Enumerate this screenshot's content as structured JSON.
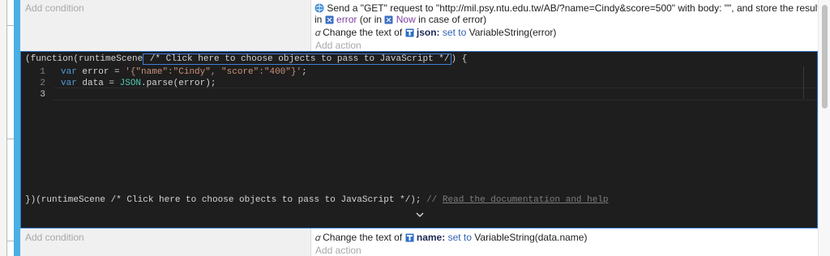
{
  "event1": {
    "condition_placeholder": "Add condition",
    "action1": {
      "prefix": "Send a \"GET\" request to \"http://mil.psy.ntu.edu.tw/AB/?name=Cindy&score=500\" with body: \"\", and store the result",
      "line2_in": "in",
      "error_var": "error",
      "or_in": "(or in",
      "now_var": "Now",
      "suffix": "in case of error)"
    },
    "action2": {
      "change_text": "Change the text of",
      "object_name": "json",
      "set_to": "set to",
      "value": "VariableString(error)"
    },
    "add_action": "Add action"
  },
  "js_event": {
    "header_pre": "(function(runtimeScene",
    "header_click": " /* Click here to choose objects to pass to JavaScript */",
    "header_post": ") {",
    "lines": [
      {
        "num": "1",
        "kw": "var",
        "ident": " error = ",
        "str": "'{\"name\":\"Cindy\", \"score\":\"400\"}'",
        "end": ";"
      },
      {
        "num": "2",
        "kw": "var",
        "ident": " data = ",
        "obj": "JSON",
        "rest": ".parse(error);"
      },
      {
        "num": "3"
      }
    ],
    "footer_code": "})(runtimeScene /* Click here to choose objects to pass to JavaScript */);",
    "footer_comment": " // ",
    "footer_link": "Read the documentation and help",
    "expand_icon": "chevron-down-icon"
  },
  "event2": {
    "condition_placeholder": "Add condition",
    "action1": {
      "change_text": "Change the text of",
      "object_name": "name",
      "set_to": "set to",
      "value": "VariableString(data.name)"
    },
    "add_action": "Add action"
  },
  "colors": {
    "accent_bar": "#4ab0e4",
    "editor_bg": "#1e1e1e",
    "keyword": "#569cd6",
    "string": "#ce9178"
  }
}
